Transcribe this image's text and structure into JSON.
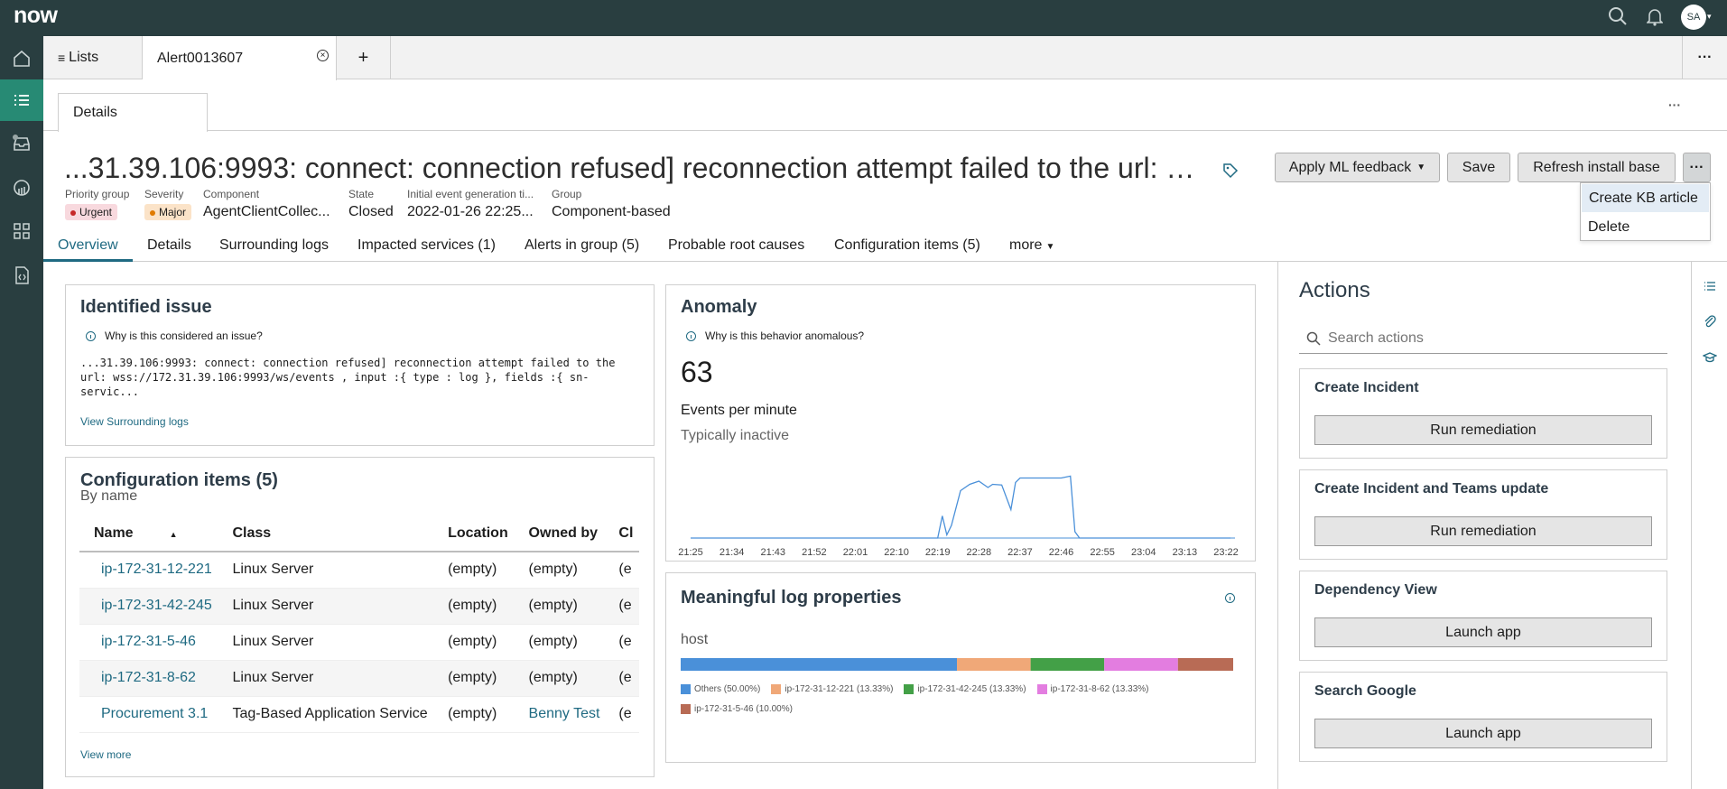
{
  "brand": {
    "logo": "now"
  },
  "header": {
    "avatar_initials": "SA"
  },
  "tabs": {
    "lists_label": "Lists",
    "record_label": "Alert0013607",
    "add_label": "+",
    "more_label": "···"
  },
  "subtab": {
    "label": "Details",
    "more_label": "···"
  },
  "record": {
    "title": "...31.39.106:9993: connect: connection refused] reconnection attempt failed to the url: …",
    "fields": [
      {
        "label": "Priority group",
        "value": "Urgent"
      },
      {
        "label": "Severity",
        "value": "Major"
      },
      {
        "label": "Component",
        "value": "AgentClientCollec..."
      },
      {
        "label": "State",
        "value": "Closed"
      },
      {
        "label": "Initial event generation ti...",
        "value": "2022-01-26 22:25..."
      },
      {
        "label": "Group",
        "value": "Component-based"
      }
    ]
  },
  "buttons": {
    "ml_feedback": "Apply ML feedback",
    "save": "Save",
    "refresh": "Refresh install base",
    "more": "···"
  },
  "dropdown": {
    "items": [
      "Create KB article",
      "Delete"
    ]
  },
  "record_tabs": [
    "Overview",
    "Details",
    "Surrounding logs",
    "Impacted services (1)",
    "Alerts in group (5)",
    "Probable root causes",
    "Configuration items (5)",
    "more"
  ],
  "identified_issue": {
    "title": "Identified issue",
    "why": "Why is this considered an issue?",
    "message_lines": [
      "...31.39.106:9993: connect: connection refused] reconnection attempt failed to the",
      "url: wss://172.31.39.106:9993/ws/events , input :{ type : log }, fields :{ sn-",
      "servic..."
    ],
    "link": "View Surrounding logs"
  },
  "config_items": {
    "title": "Configuration items (5)",
    "subtitle": "By name",
    "columns": [
      "Name",
      "Class",
      "Location",
      "Owned by",
      "Cl"
    ],
    "rows": [
      {
        "name": "ip-172-31-12-221",
        "class": "Linux Server",
        "location": "(empty)",
        "owned_by": "(empty)",
        "cl": "(e"
      },
      {
        "name": "ip-172-31-42-245",
        "class": "Linux Server",
        "location": "(empty)",
        "owned_by": "(empty)",
        "cl": "(e"
      },
      {
        "name": "ip-172-31-5-46",
        "class": "Linux Server",
        "location": "(empty)",
        "owned_by": "(empty)",
        "cl": "(e"
      },
      {
        "name": "ip-172-31-8-62",
        "class": "Linux Server",
        "location": "(empty)",
        "owned_by": "(empty)",
        "cl": "(e"
      },
      {
        "name": "Procurement 3.1",
        "class": "Tag-Based Application Service",
        "location": "(empty)",
        "owned_by": "Benny Test",
        "cl": "(e"
      }
    ],
    "view_more": "View more"
  },
  "anomaly": {
    "title": "Anomaly",
    "why": "Why is this behavior anomalous?",
    "value": "63",
    "unit": "Events per minute",
    "typical": "Typically inactive"
  },
  "log_props": {
    "title": "Meaningful log properties",
    "field": "host"
  },
  "actions": {
    "title": "Actions",
    "search_placeholder": "Search actions",
    "cards": [
      {
        "title": "Create Incident",
        "button": "Run remediation"
      },
      {
        "title": "Create Incident and Teams update",
        "button": "Run remediation"
      },
      {
        "title": "Dependency View",
        "button": "Launch app"
      },
      {
        "title": "Search Google",
        "button": "Launch app"
      }
    ]
  },
  "chart_data": [
    {
      "type": "line",
      "title": "",
      "x_ticks": [
        "21:25",
        "21:34",
        "21:43",
        "21:52",
        "22:01",
        "22:10",
        "22:19",
        "22:28",
        "22:37",
        "22:46",
        "22:55",
        "23:04",
        "23:13",
        "23:22"
      ],
      "series": [
        {
          "x": [
            "21:25",
            "22:19",
            "22:20",
            "22:21",
            "22:22",
            "22:24",
            "22:26",
            "22:28",
            "22:30",
            "22:31",
            "22:33",
            "22:35",
            "22:36",
            "22:37",
            "22:38",
            "22:40",
            "22:42",
            "22:44",
            "22:46",
            "22:48",
            "22:49",
            "22:50",
            "22:51",
            "22:52",
            "23:23"
          ],
          "y": [
            0,
            0,
            35,
            5,
            20,
            75,
            85,
            90,
            80,
            85,
            84,
            45,
            88,
            95,
            95,
            95,
            95,
            95,
            95,
            98,
            10,
            0,
            0,
            0,
            0
          ]
        }
      ],
      "ylim": [
        0,
        100
      ]
    },
    {
      "type": "bar",
      "orientation": "stacked-horizontal",
      "categories": [
        "Others",
        "ip-172-31-12-221",
        "ip-172-31-42-245",
        "ip-172-31-8-62",
        "ip-172-31-5-46"
      ],
      "values": [
        50.0,
        13.33,
        13.33,
        13.33,
        10.0
      ],
      "legend_labels": [
        "Others (50.00%)",
        "ip-172-31-12-221 (13.33%)",
        "ip-172-31-42-245 (13.33%)",
        "ip-172-31-8-62 (13.33%)",
        "ip-172-31-5-46 (10.00%)"
      ],
      "colors": [
        "#4a90d9",
        "#f0a878",
        "#43a047",
        "#e37de0",
        "#b86b55"
      ]
    }
  ]
}
